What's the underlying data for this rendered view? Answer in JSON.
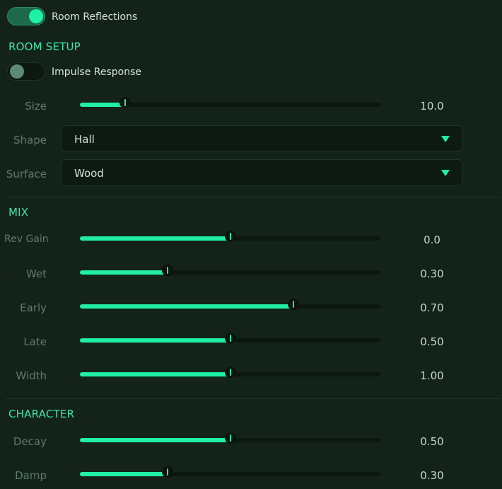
{
  "toggles": {
    "room_reflections": {
      "label": "Room Reflections",
      "on": true
    },
    "impulse_response": {
      "label": "Impulse Response",
      "on": false
    }
  },
  "sections": {
    "room_setup": "ROOM SETUP",
    "mix": "MIX",
    "character": "CHARACTER"
  },
  "room_setup": {
    "size": {
      "label": "Size",
      "value": "10.0",
      "fraction": 0.15
    },
    "shape": {
      "label": "Shape",
      "selected": "Hall"
    },
    "surface": {
      "label": "Surface",
      "selected": "Wood"
    }
  },
  "mix": {
    "rev_gain": {
      "label": "Rev Gain",
      "value": "0.0",
      "fraction": 0.5
    },
    "wet": {
      "label": "Wet",
      "value": "0.30",
      "fraction": 0.29
    },
    "early": {
      "label": "Early",
      "value": "0.70",
      "fraction": 0.71
    },
    "late": {
      "label": "Late",
      "value": "0.50",
      "fraction": 0.5
    },
    "width": {
      "label": "Width",
      "value": "1.00",
      "fraction": 0.5
    }
  },
  "character": {
    "decay": {
      "label": "Decay",
      "value": "0.50",
      "fraction": 0.5
    },
    "damp": {
      "label": "Damp",
      "value": "0.30",
      "fraction": 0.29
    }
  },
  "colors": {
    "accent": "#1ff0a6",
    "background": "#13231b"
  }
}
